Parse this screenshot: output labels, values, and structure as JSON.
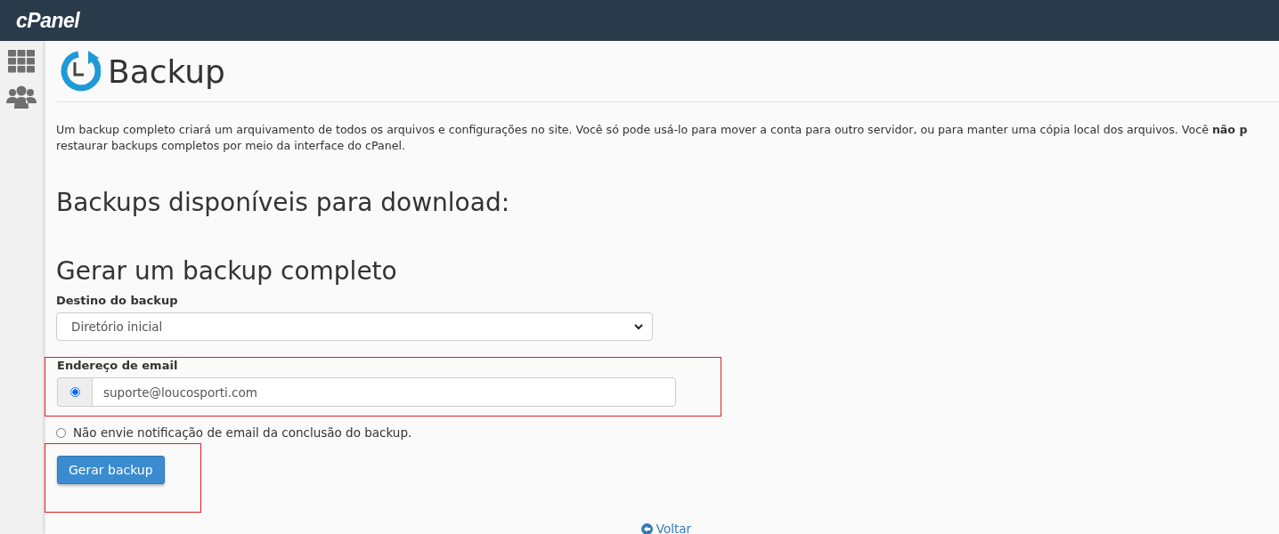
{
  "brand": "cPanel",
  "sidebar": {
    "items": [
      {
        "kind": "grid"
      },
      {
        "kind": "users"
      }
    ]
  },
  "page": {
    "title": "Backup",
    "intro_lines": [
      "Um backup completo criará um arquivamento de todos os arquivos e configurações no site. Você só pode usá-lo para mover a conta para outro servidor, ou para manter uma cópia local dos arquivos. Você **não p**",
      "restaurar backups completos por meio da interface do cPanel."
    ],
    "available_heading": "Backups disponíveis para download:",
    "generate_heading": "Gerar um backup completo",
    "destination": {
      "label": "Destino do backup",
      "value": "Diretório inicial"
    },
    "email": {
      "label": "Endereço de email",
      "value": "suporte@loucosporti.com",
      "selected": true,
      "highlighted": true
    },
    "no_notify": {
      "label": "Não envie notificação de email da conclusão do backup.",
      "selected": false
    },
    "submit": {
      "label": "Gerar backup",
      "highlighted": true
    },
    "back_link": "Voltar"
  }
}
